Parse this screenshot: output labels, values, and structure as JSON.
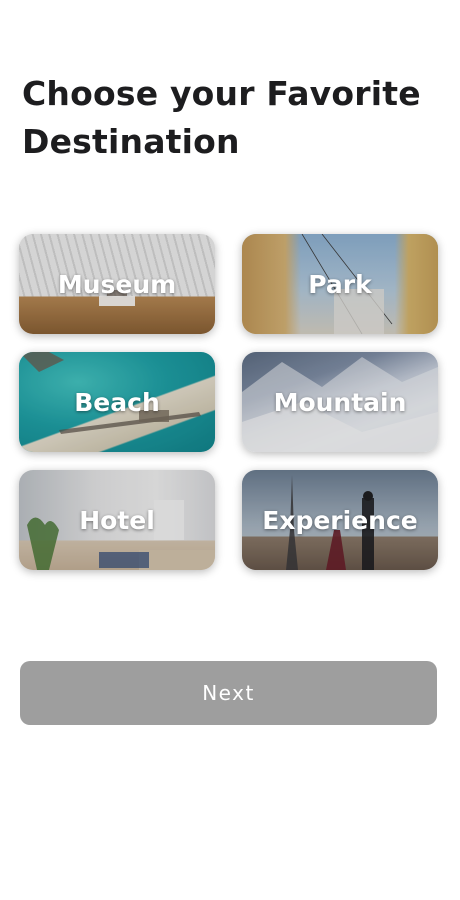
{
  "header": {
    "title": "Choose your Favorite Destination"
  },
  "destinations": [
    {
      "label": "Museum",
      "image": "museum-photo"
    },
    {
      "label": "Park",
      "image": "park-photo"
    },
    {
      "label": "Beach",
      "image": "beach-photo"
    },
    {
      "label": "Mountain",
      "image": "mountain-photo"
    },
    {
      "label": "Hotel",
      "image": "hotel-photo"
    },
    {
      "label": "Experience",
      "image": "experience-photo"
    }
  ],
  "footer": {
    "next_label": "Next"
  },
  "colors": {
    "title": "#1d1d1f",
    "button_bg": "#9e9e9e",
    "button_text": "#ffffff",
    "card_text": "#ffffff"
  }
}
